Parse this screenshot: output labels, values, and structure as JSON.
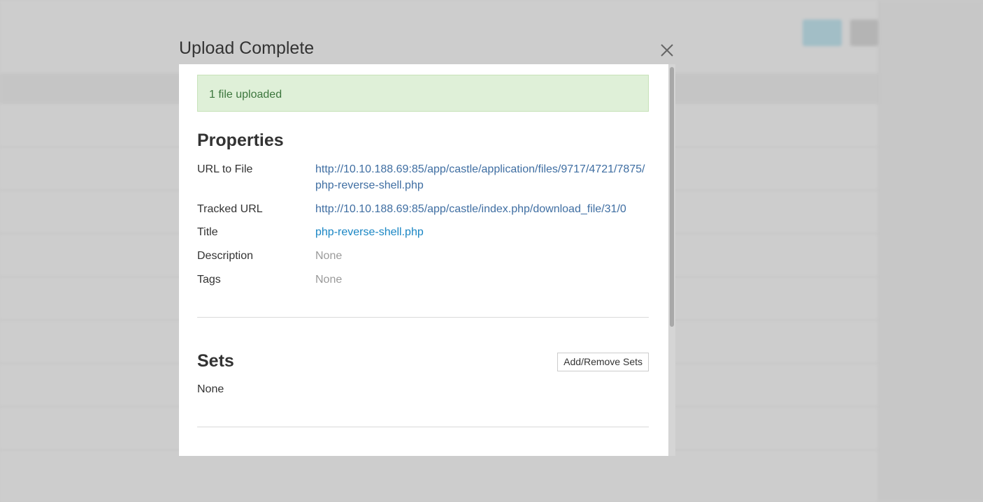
{
  "modal": {
    "title": "Upload Complete",
    "close_icon": "close-icon",
    "alert_text": "1 file uploaded",
    "properties": {
      "heading": "Properties",
      "rows": [
        {
          "label": "URL to File",
          "value": "http://10.10.188.69:85/app/castle/application/files/9717/4721/7875/php-reverse-shell.php",
          "type": "link"
        },
        {
          "label": "Tracked URL",
          "value": "http://10.10.188.69:85/app/castle/index.php/download_file/31/0",
          "type": "link"
        },
        {
          "label": "Title",
          "value": "php-reverse-shell.php",
          "type": "title-link"
        },
        {
          "label": "Description",
          "value": "None",
          "type": "muted"
        },
        {
          "label": "Tags",
          "value": "None",
          "type": "muted"
        }
      ]
    },
    "sets": {
      "heading": "Sets",
      "button_label": "Add/Remove Sets",
      "value": "None"
    }
  },
  "colors": {
    "alert_bg": "#dff0d8",
    "alert_text": "#3c763d",
    "link": "#3f6ea2",
    "title_link": "#1a86c4"
  }
}
